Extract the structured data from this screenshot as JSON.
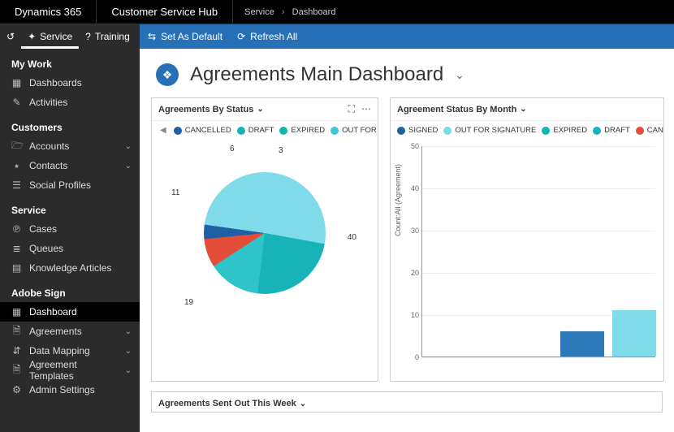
{
  "topbar": {
    "brand": "Dynamics 365",
    "hub": "Customer Service Hub",
    "breadcrumb": [
      "Service",
      "Dashboard"
    ]
  },
  "leftTabs": {
    "service": "Service",
    "training": "Training"
  },
  "commands": {
    "setDefault": "Set As Default",
    "refresh": "Refresh All"
  },
  "sidebar": {
    "groups": [
      {
        "title": "My Work",
        "items": [
          {
            "icon": "▦",
            "label": "Dashboards",
            "expandable": false
          },
          {
            "icon": "✎",
            "label": "Activities",
            "expandable": false
          }
        ]
      },
      {
        "title": "Customers",
        "items": [
          {
            "icon": "🗁",
            "label": "Accounts",
            "expandable": true
          },
          {
            "icon": "⭑",
            "label": "Contacts",
            "expandable": true
          },
          {
            "icon": "☰",
            "label": "Social Profiles",
            "expandable": false
          }
        ]
      },
      {
        "title": "Service",
        "items": [
          {
            "icon": "℗",
            "label": "Cases",
            "expandable": false
          },
          {
            "icon": "≣",
            "label": "Queues",
            "expandable": false
          },
          {
            "icon": "▤",
            "label": "Knowledge Articles",
            "expandable": false
          }
        ]
      },
      {
        "title": "Adobe Sign",
        "items": [
          {
            "icon": "▦",
            "label": "Dashboard",
            "expandable": false,
            "active": true
          },
          {
            "icon": "🗎",
            "label": "Agreements",
            "expandable": true
          },
          {
            "icon": "⇵",
            "label": "Data Mapping",
            "expandable": true
          },
          {
            "icon": "🗎",
            "label": "Agreement Templates",
            "expandable": true
          },
          {
            "icon": "⚙",
            "label": "Admin Settings",
            "expandable": false
          }
        ]
      }
    ]
  },
  "page": {
    "title": "Agreements Main Dashboard"
  },
  "card1": {
    "title": "Agreements By Status",
    "legend": [
      {
        "label": "CANCELLED",
        "color": "#1e5fa6"
      },
      {
        "label": "DRAFT",
        "color": "#17b3b8"
      },
      {
        "label": "EXPIRED",
        "color": "#0fb5ae"
      },
      {
        "label": "OUT FOR S",
        "color": "#3cc8d9"
      }
    ]
  },
  "card2": {
    "title": "Agreement Status By Month",
    "legend": [
      {
        "label": "SIGNED",
        "color": "#1e5fa6"
      },
      {
        "label": "OUT FOR SIGNATURE",
        "color": "#7dd9e8"
      },
      {
        "label": "EXPIRED",
        "color": "#0fb5ae"
      },
      {
        "label": "DRAFT",
        "color": "#17b3b8"
      },
      {
        "label": "CANCELLED",
        "color": "#e34d3a"
      }
    ],
    "ylabel": "Count:All (Agreement)"
  },
  "card3": {
    "title": "Agreements Sent Out This Week"
  },
  "chart_data": [
    {
      "type": "pie",
      "title": "Agreements By Status",
      "series": [
        {
          "name": "OUT FOR SIGNATURE",
          "value": 40,
          "color": "#7fdbea"
        },
        {
          "name": "DRAFT",
          "value": 19,
          "color": "#17b3b8"
        },
        {
          "name": "EXPIRED",
          "value": 11,
          "color": "#2fc4c9"
        },
        {
          "name": "CANCELLED",
          "value": 6,
          "color": "#e34d3a"
        },
        {
          "name": "SIGNED",
          "value": 3,
          "color": "#1e5fa6"
        }
      ],
      "labels": [
        "40",
        "19",
        "11",
        "6",
        "3"
      ]
    },
    {
      "type": "bar",
      "title": "Agreement Status By Month",
      "ylabel": "Count:All (Agreement)",
      "ylim": [
        0,
        50
      ],
      "yticks": [
        0,
        10,
        20,
        30,
        40,
        50
      ],
      "series": [
        {
          "name": "SIGNED",
          "value": 6,
          "color": "#2d78b9"
        },
        {
          "name": "OUT FOR SIGNATURE",
          "value": 11,
          "color": "#7fdbea"
        }
      ]
    }
  ]
}
